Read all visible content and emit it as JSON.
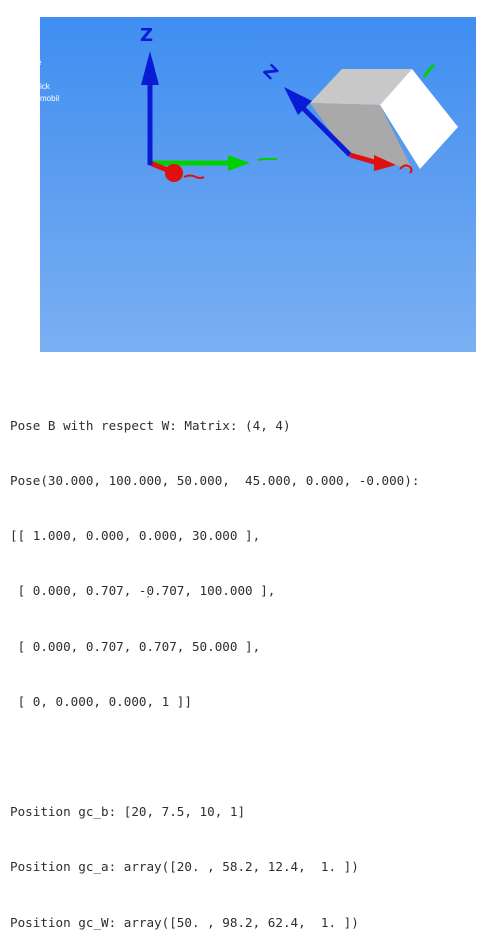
{
  "viewport": {
    "background_top": "#3f8ef2",
    "background_bottom": "#7bb0f3",
    "hud_lines": [
      "e",
      "",
      "ick",
      "mobil"
    ],
    "frame_w": {
      "z_label": "Z",
      "axes": [
        "z",
        "x",
        "y"
      ]
    },
    "frame_b": {
      "z_label": "Z",
      "axes": [
        "z",
        "x",
        "y"
      ],
      "object": "cube"
    },
    "colors": {
      "x_axis": "#e01010",
      "y_axis": "#00d000",
      "z_axis": "#0a1bd6",
      "cube_top": "#c8c8c8",
      "cube_side": "#a9a9a9",
      "cube_front": "#ffffff"
    }
  },
  "console": {
    "lines": [
      "Pose B with respect W: Matrix: (4, 4)",
      "Pose(30.000, 100.000, 50.000,  45.000, 0.000, -0.000):",
      "[[ 1.000, 0.000, 0.000, 30.000 ],",
      " [ 0.000, 0.707, -0.707, 100.000 ],",
      " [ 0.000, 0.707, 0.707, 50.000 ],",
      " [ 0, 0.000, 0.000, 1 ]]",
      "",
      "Position gc_b: [20, 7.5, 10, 1]",
      "Position gc_a: array([20. , 58.2, 12.4,  1. ])",
      "Position gc_W: array([50. , 98.2, 62.4,  1. ])"
    ],
    "cut_off_line": "'"
  }
}
